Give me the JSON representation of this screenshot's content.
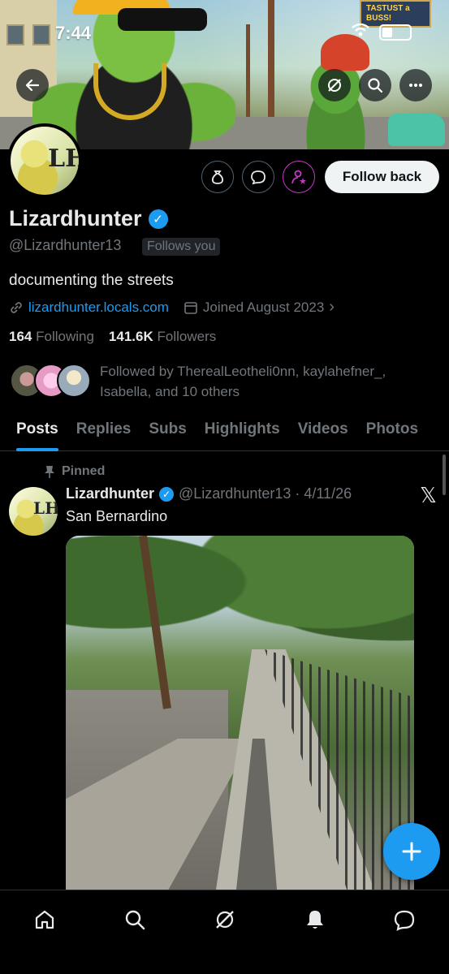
{
  "status_bar": {
    "time": "7:44"
  },
  "banner_sign": "TASTUST a BUSS!",
  "profile": {
    "name": "Lizardhunter",
    "handle": "@Lizardhunter13",
    "follows_you": "Follows you",
    "bio": "documenting the streets",
    "link": "lizardhunter.locals.com",
    "joined": "Joined August 2023",
    "following_count": "164",
    "following_label": "Following",
    "followers_count": "141.6K",
    "followers_label": "Followers",
    "followed_by": "Followed by TherealLeotheli0nn, kaylahefner_, Isabella, and 10 others",
    "avatar_monogram": "LH"
  },
  "buttons": {
    "follow_back": "Follow back"
  },
  "tabs": [
    {
      "label": "Posts",
      "active": true
    },
    {
      "label": "Replies"
    },
    {
      "label": "Subs"
    },
    {
      "label": "Highlights"
    },
    {
      "label": "Videos"
    },
    {
      "label": "Photos"
    }
  ],
  "pinned_post": {
    "pinned_label": "Pinned",
    "author": "Lizardhunter",
    "handle_date": "@Lizardhunter13 · 4/11/26",
    "text": "San Bernardino"
  },
  "icons": {
    "back": "arrow-left-icon",
    "grok": "grok-icon",
    "search": "search-icon",
    "more": "more-icon",
    "money": "money-bag-icon",
    "message": "message-icon",
    "subscribe": "person-star-icon",
    "home": "home-icon",
    "notifications": "bell-icon",
    "messages": "chat-icon"
  },
  "colors": {
    "accent": "#1d9bf0",
    "background": "#000000",
    "subscribe_accent": "#c936cc"
  }
}
